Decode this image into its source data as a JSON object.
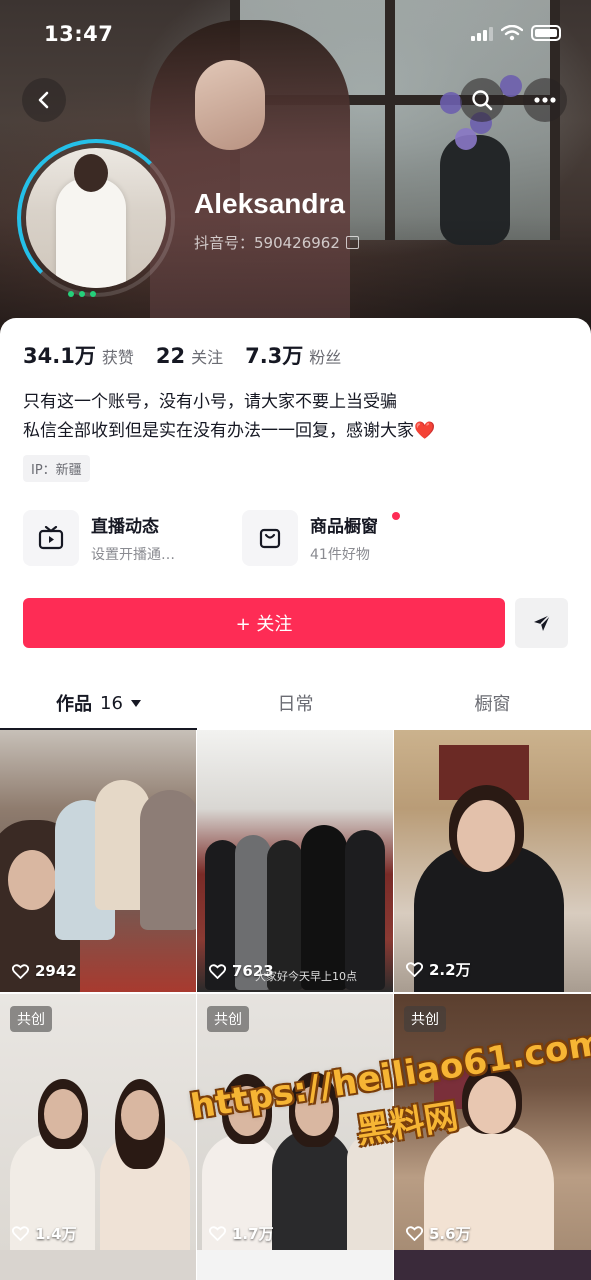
{
  "status_bar": {
    "time": "13:47"
  },
  "profile": {
    "nickname": "Aleksandra",
    "douyin_id": "抖音号：590426962",
    "stats": [
      {
        "value": "34.1万",
        "label": "获赞"
      },
      {
        "value": "22",
        "label": "关注"
      },
      {
        "value": "7.3万",
        "label": "粉丝"
      }
    ],
    "bio_lines": [
      "只有这一个账号，没有小号，请大家不要上当受骗",
      "私信全部收到但是实在没有办法一一回复，感谢大家"
    ],
    "bio_emoji": "❤️",
    "ip": "IP：新疆"
  },
  "entries": {
    "live": {
      "title": "直播动态",
      "subtitle": "设置开播通…"
    },
    "shop": {
      "title": "商品橱窗",
      "subtitle": "41件好物"
    }
  },
  "actions": {
    "follow_label": "+ 关注"
  },
  "tabs": [
    {
      "label": "作品",
      "count": "16"
    },
    {
      "label": "日常"
    },
    {
      "label": "橱窗"
    }
  ],
  "videos": [
    {
      "likes": "2942",
      "collab": ""
    },
    {
      "likes": "7623",
      "collab": "",
      "caption": "大家好今天早上10点"
    },
    {
      "likes": "2.2万",
      "collab": ""
    },
    {
      "likes": "1.4万",
      "collab": "共创"
    },
    {
      "likes": "1.7万",
      "collab": "共创"
    },
    {
      "likes": "5.6万",
      "collab": "共创"
    }
  ],
  "watermark": {
    "url": "https://heiliao61.com",
    "name": "黑料网"
  },
  "colors": {
    "accent": "#fe2c55",
    "ring": "#25c0e8",
    "text": "#161823"
  }
}
